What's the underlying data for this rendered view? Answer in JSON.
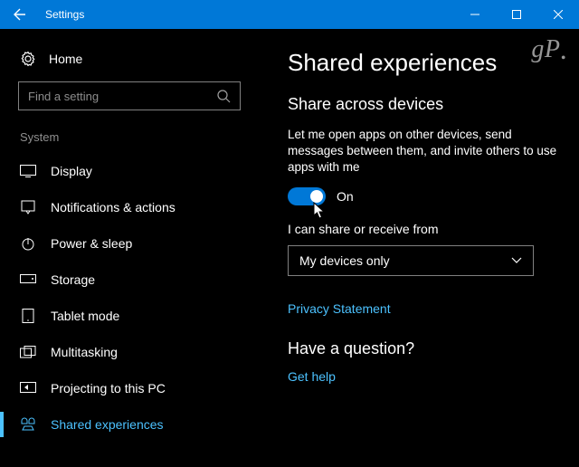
{
  "titlebar": {
    "title": "Settings"
  },
  "sidebar": {
    "home": "Home",
    "search_placeholder": "Find a setting",
    "group": "System",
    "items": [
      {
        "label": "Display"
      },
      {
        "label": "Notifications & actions"
      },
      {
        "label": "Power & sleep"
      },
      {
        "label": "Storage"
      },
      {
        "label": "Tablet mode"
      },
      {
        "label": "Multitasking"
      },
      {
        "label": "Projecting to this PC"
      },
      {
        "label": "Shared experiences"
      }
    ]
  },
  "main": {
    "heading": "Shared experiences",
    "section1_title": "Share across devices",
    "section1_desc": "Let me open apps on other devices, send messages between them, and invite others to use apps with me",
    "toggle_state": "On",
    "share_from_label": "I can share or receive from",
    "share_from_value": "My devices only",
    "privacy_link": "Privacy Statement",
    "question_heading": "Have a question?",
    "help_link": "Get help"
  },
  "watermark": "gP"
}
